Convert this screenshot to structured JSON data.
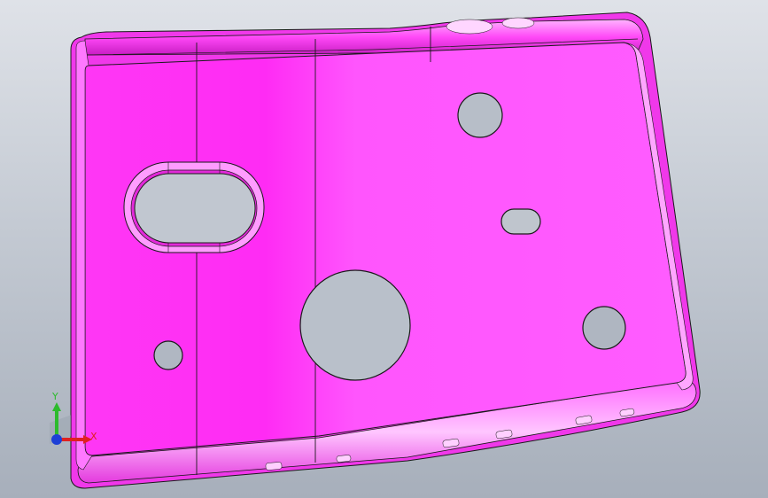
{
  "viewport": {
    "background_top": "#dfe2e8",
    "background_bottom": "#a7afbb"
  },
  "part": {
    "color": "#ff5aff",
    "highlight": "#ff2bf4",
    "edge_color": "#1a1a1a",
    "holes": [
      "slot-large",
      "hole-top-right",
      "slot-small",
      "hole-center-large",
      "hole-bottom-left",
      "hole-bottom-right"
    ]
  },
  "triad": {
    "y_label": "Y",
    "x_label": "X",
    "y_color": "#2dbb2d",
    "x_color": "#e02020",
    "z_color": "#1d3fd6"
  }
}
